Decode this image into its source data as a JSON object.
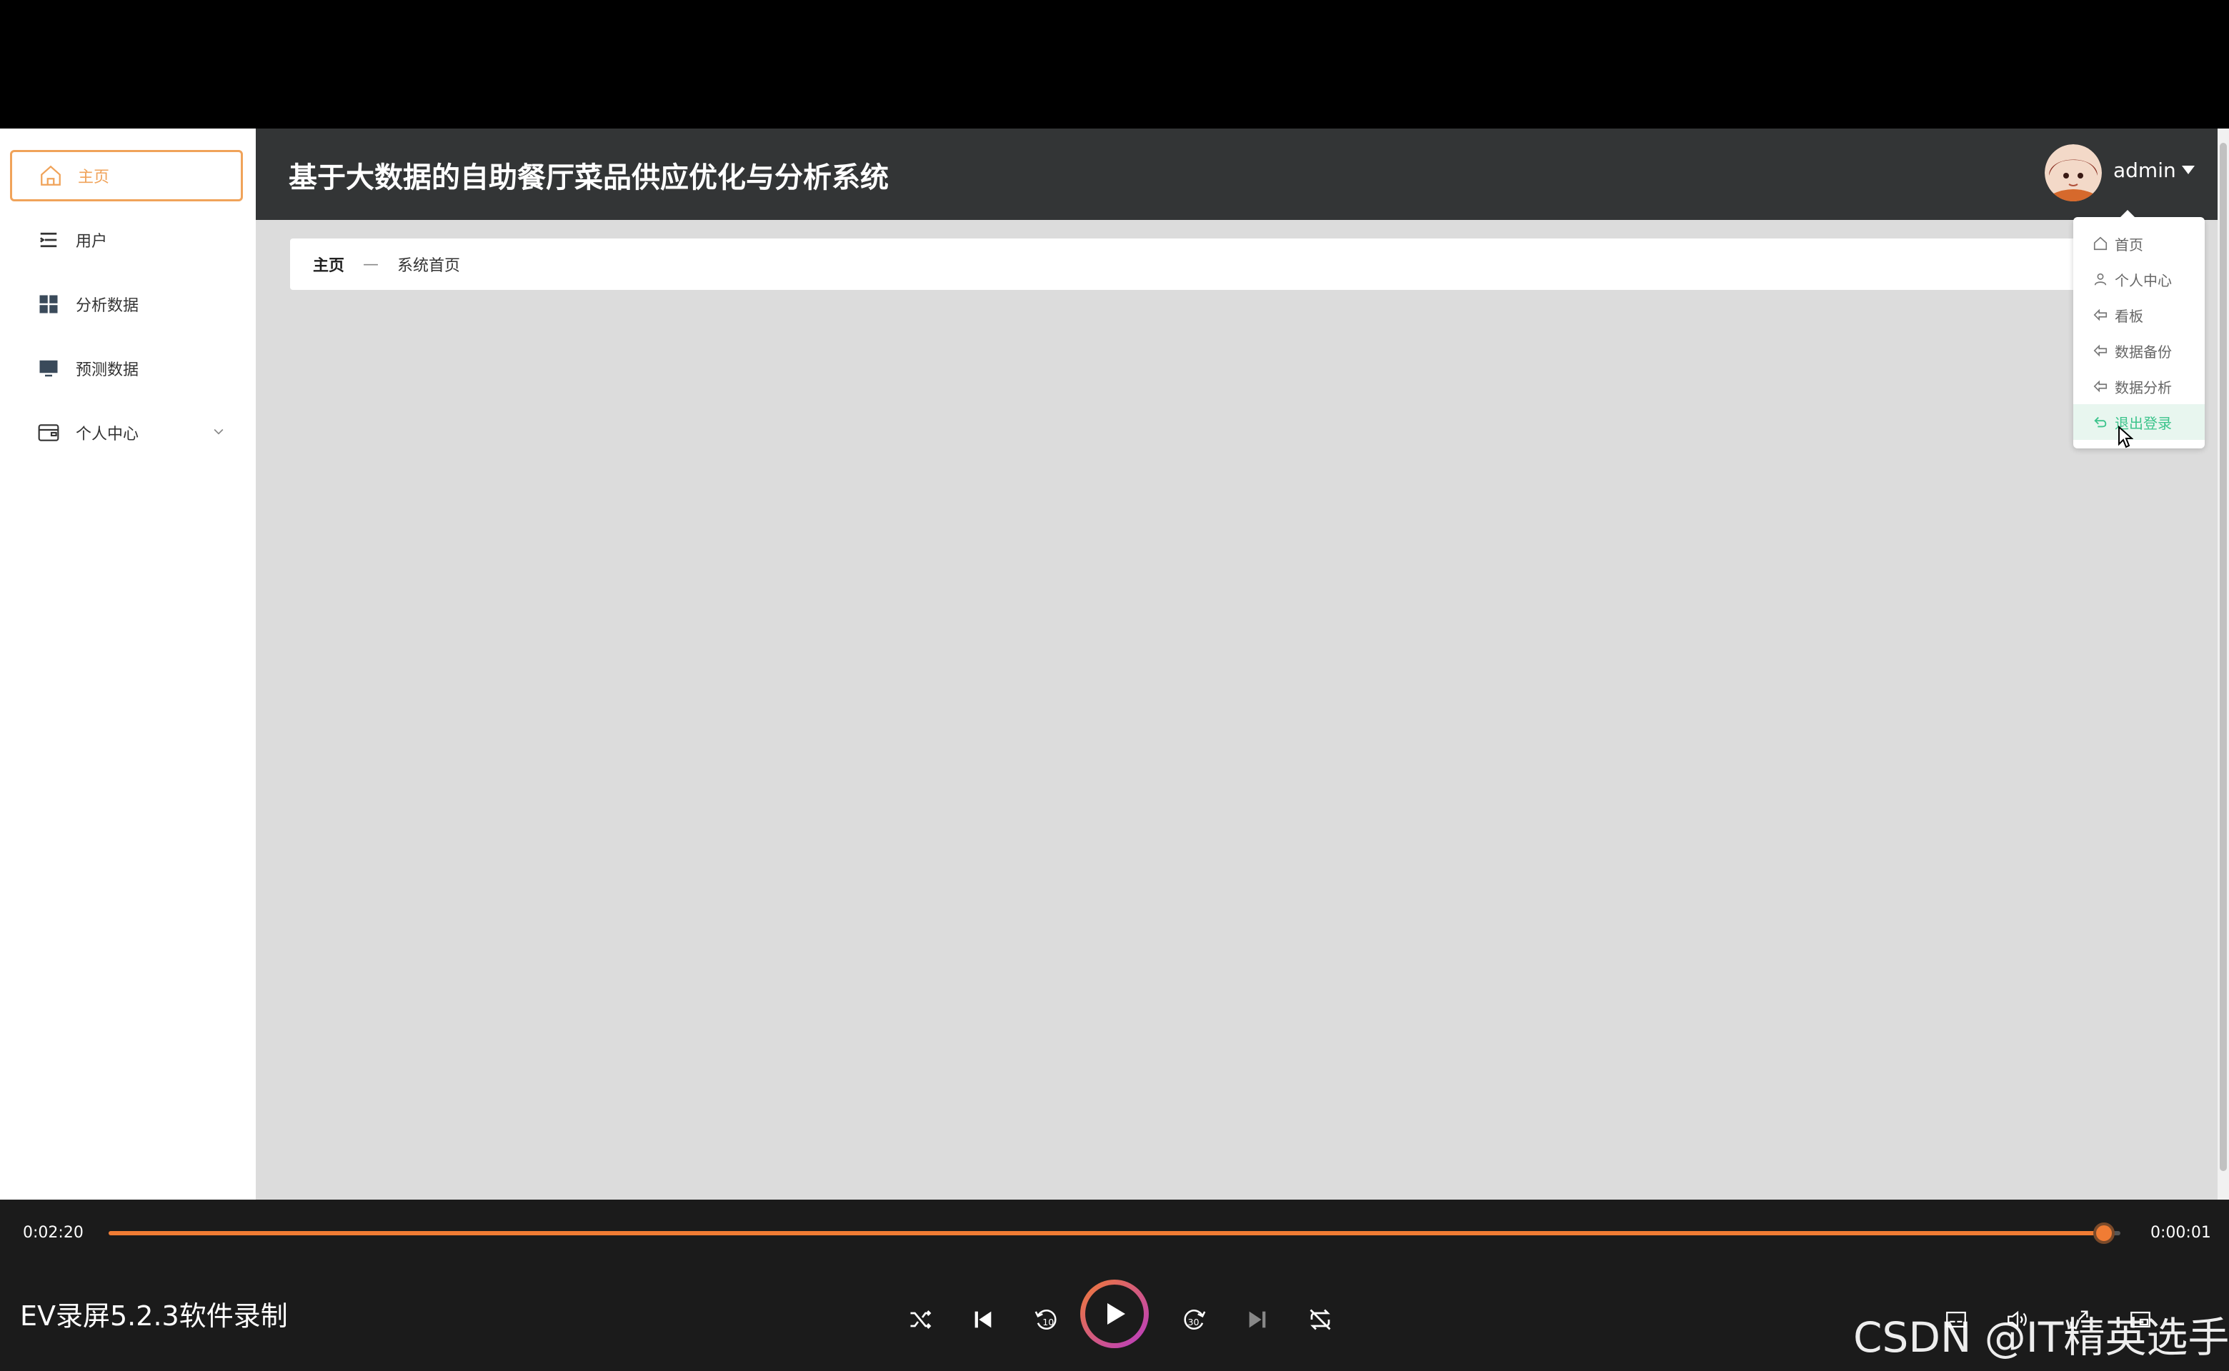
{
  "app": {
    "title": "基于大数据的自助餐厅菜品供应优化与分析系统",
    "user": "admin"
  },
  "sidebar": {
    "items": [
      {
        "label": "主页",
        "icon": "home-icon",
        "active": true
      },
      {
        "label": "用户",
        "icon": "list-icon"
      },
      {
        "label": "分析数据",
        "icon": "grid-icon"
      },
      {
        "label": "预测数据",
        "icon": "monitor-icon"
      },
      {
        "label": "个人中心",
        "icon": "wallet-icon",
        "expandable": true
      }
    ]
  },
  "breadcrumb": {
    "home": "主页",
    "separator": "—",
    "current": "系统首页"
  },
  "user_menu": {
    "items": [
      {
        "label": "首页",
        "icon": "home-icon"
      },
      {
        "label": "个人中心",
        "icon": "user-icon"
      },
      {
        "label": "看板",
        "icon": "back-arrow-icon"
      },
      {
        "label": "数据备份",
        "icon": "back-arrow-icon"
      },
      {
        "label": "数据分析",
        "icon": "back-arrow-icon"
      },
      {
        "label": "退出登录",
        "icon": "logout-icon",
        "hover": true
      }
    ]
  },
  "player": {
    "elapsed": "0:02:20",
    "remaining": "0:00:01",
    "progress": 0.992,
    "title": "EV录屏5.2.3软件录制",
    "accent": "#f07c34",
    "watermark": "CSDN @IT精英选手"
  }
}
